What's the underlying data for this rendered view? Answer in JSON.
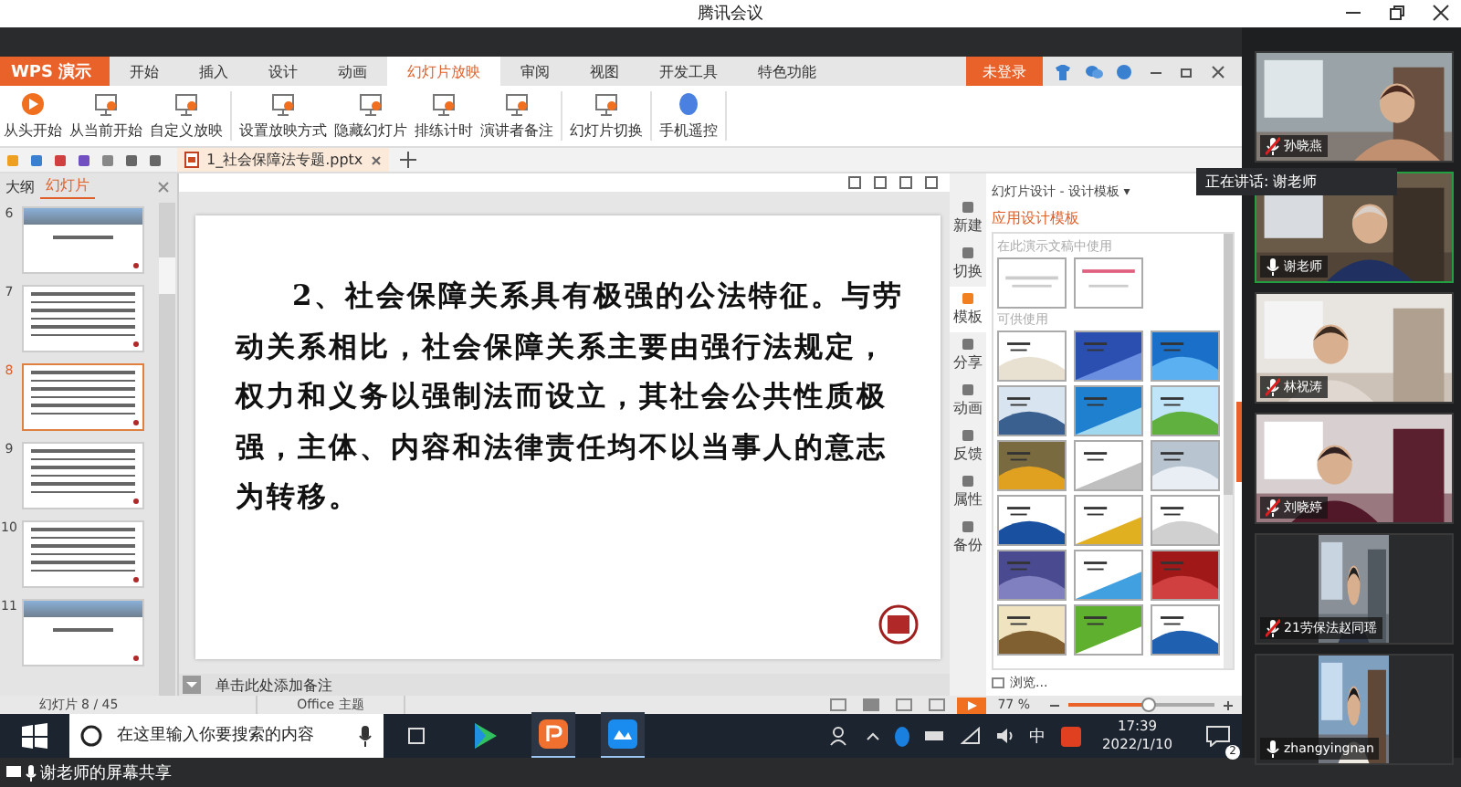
{
  "window": {
    "title": "腾讯会议"
  },
  "wps": {
    "app_button": "WPS 演示",
    "tabs": [
      {
        "label": "开始",
        "selected": false
      },
      {
        "label": "插入",
        "selected": false
      },
      {
        "label": "设计",
        "selected": false
      },
      {
        "label": "动画",
        "selected": false
      },
      {
        "label": "幻灯片放映",
        "selected": true
      },
      {
        "label": "审阅",
        "selected": false
      },
      {
        "label": "视图",
        "selected": false
      },
      {
        "label": "开发工具",
        "selected": false
      },
      {
        "label": "特色功能",
        "selected": false
      }
    ],
    "login_button": "未登录",
    "ribbon_groups": [
      [
        "从头开始",
        "从当前开始",
        "自定义放映"
      ],
      [
        "设置放映方式",
        "隐藏幻灯片",
        "排练计时",
        "演讲者备注"
      ],
      [
        "幻灯片切换"
      ],
      [
        "手机遥控"
      ]
    ],
    "document_tab": "1_社会保障法专题.pptx",
    "side_tabs": [
      {
        "label": "大纲",
        "selected": false
      },
      {
        "label": "幻灯片",
        "selected": true
      }
    ],
    "slides": [
      {
        "number": "6",
        "kind": "title",
        "selected": false
      },
      {
        "number": "7",
        "kind": "text",
        "selected": false
      },
      {
        "number": "8",
        "kind": "text",
        "selected": true
      },
      {
        "number": "9",
        "kind": "text",
        "selected": false
      },
      {
        "number": "10",
        "kind": "text",
        "selected": false
      },
      {
        "number": "11",
        "kind": "title",
        "selected": false
      }
    ],
    "slide_text": "2、社会保障关系具有极强的公法特征。与劳动关系相比，社会保障关系主要由强行法规定，权力和义务以强制法而设立，其社会公共性质极强，主体、内容和法律责任均不以当事人的意志为转移。",
    "notes_placeholder": "单击此处添加备注",
    "side_panel": [
      {
        "label": "新建",
        "selected": false
      },
      {
        "label": "切换",
        "selected": false
      },
      {
        "label": "模板",
        "selected": true
      },
      {
        "label": "分享",
        "selected": false
      },
      {
        "label": "动画",
        "selected": false
      },
      {
        "label": "反馈",
        "selected": false
      },
      {
        "label": "属性",
        "selected": false
      },
      {
        "label": "备份",
        "selected": false
      }
    ],
    "task_pane": {
      "title": "幻灯片设计 - 设计模板 ▾",
      "heading": "应用设计模板",
      "section_current": "在此演示文稿中使用",
      "section_available": "可供使用",
      "browse": "浏览..."
    },
    "status_bar": {
      "slide_count": "幻灯片 8 / 45",
      "theme": "Office 主题",
      "zoom": "77 %",
      "zoom_slider": {
        "level": 0.55
      }
    }
  },
  "taskbar": {
    "search_placeholder": "在这里输入你要搜索的内容",
    "ime": "中",
    "time": "17:39",
    "date": "2022/1/10",
    "notifications": "2"
  },
  "meeting": {
    "speaking": "正在讲话: 谢老师",
    "participants": [
      {
        "name": "孙晓燕",
        "kind": "full",
        "muted": true
      },
      {
        "name": "谢老师",
        "kind": "full",
        "muted": false
      },
      {
        "name": "林祝涛",
        "kind": "full",
        "muted": true
      },
      {
        "name": "刘晓婷",
        "kind": "full",
        "muted": true
      },
      {
        "name": "21劳保法赵同瑶",
        "kind": "portrait",
        "muted": true
      },
      {
        "name": "zhangyingnan",
        "kind": "portrait",
        "muted": false
      }
    ],
    "share_label": "谢老师的屏幕共享"
  }
}
